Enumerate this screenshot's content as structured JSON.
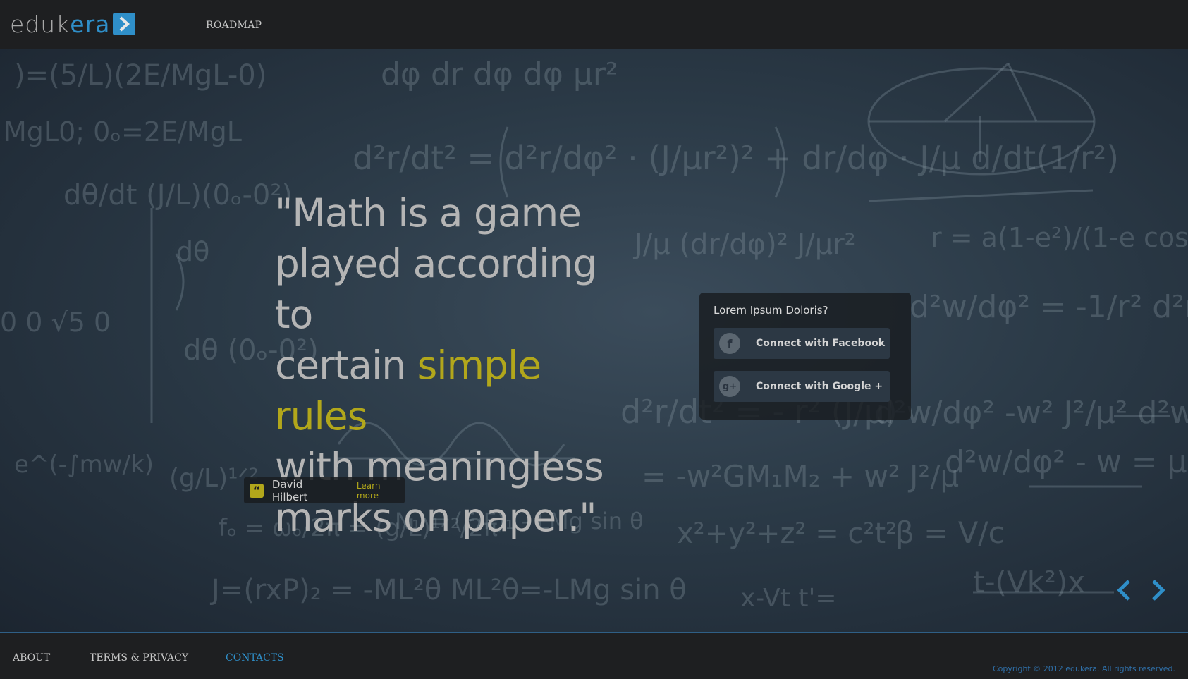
{
  "header": {
    "logo_text_part1": "eduk",
    "logo_text_part2": "era",
    "nav_roadmap": "ROADMAP"
  },
  "hero": {
    "quote_line1": "\"Math is a game",
    "quote_line2": "played according to",
    "quote_line3_pre": "certain ",
    "quote_line3_highlight": "simple rules",
    "quote_line4": "with meaningless",
    "quote_line5": "marks on paper.\"",
    "author": "David Hilbert",
    "learn_more": "Learn more",
    "highlight_color": "#b2a71b"
  },
  "login_panel": {
    "title": "Lorem Ipsum Doloris?",
    "facebook_label": "Connect with Facebook",
    "facebook_icon": "f",
    "google_label": "Connect with Google +",
    "google_icon": "g+"
  },
  "footer": {
    "about": "ABOUT",
    "terms": "TERMS & PRIVACY",
    "contacts": "CONTACTS",
    "copyright": "Copyright © 2012 edukera. All rights reserved."
  },
  "colors": {
    "accent_blue": "#2f8fc9",
    "accent_yellow": "#b2a71b"
  }
}
